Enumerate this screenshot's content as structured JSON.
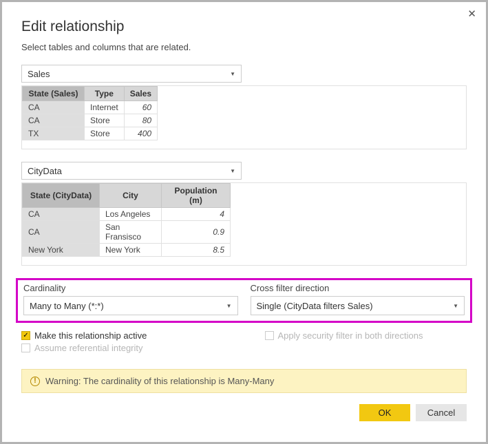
{
  "dialog": {
    "title": "Edit relationship",
    "subtitle": "Select tables and columns that are related."
  },
  "table1": {
    "selected": "Sales",
    "columns": [
      "State (Sales)",
      "Type",
      "Sales"
    ],
    "rows": [
      {
        "state": "CA",
        "type": "Internet",
        "sales": "60"
      },
      {
        "state": "CA",
        "type": "Store",
        "sales": "80"
      },
      {
        "state": "TX",
        "type": "Store",
        "sales": "400"
      }
    ]
  },
  "table2": {
    "selected": "CityData",
    "columns": [
      "State (CityData)",
      "City",
      "Population (m)"
    ],
    "rows": [
      {
        "state": "CA",
        "city": "Los Angeles",
        "pop": "4"
      },
      {
        "state": "CA",
        "city": "San Fransisco",
        "pop": "0.9"
      },
      {
        "state": "New York",
        "city": "New York",
        "pop": "8.5"
      }
    ]
  },
  "cardinality": {
    "label": "Cardinality",
    "value": "Many to Many (*:*)"
  },
  "crossfilter": {
    "label": "Cross filter direction",
    "value": "Single (CityData filters Sales)"
  },
  "checks": {
    "active": "Make this relationship active",
    "security": "Apply security filter in both directions",
    "referential": "Assume referential integrity"
  },
  "warning": "Warning: The cardinality of this relationship is Many-Many",
  "buttons": {
    "ok": "OK",
    "cancel": "Cancel"
  }
}
